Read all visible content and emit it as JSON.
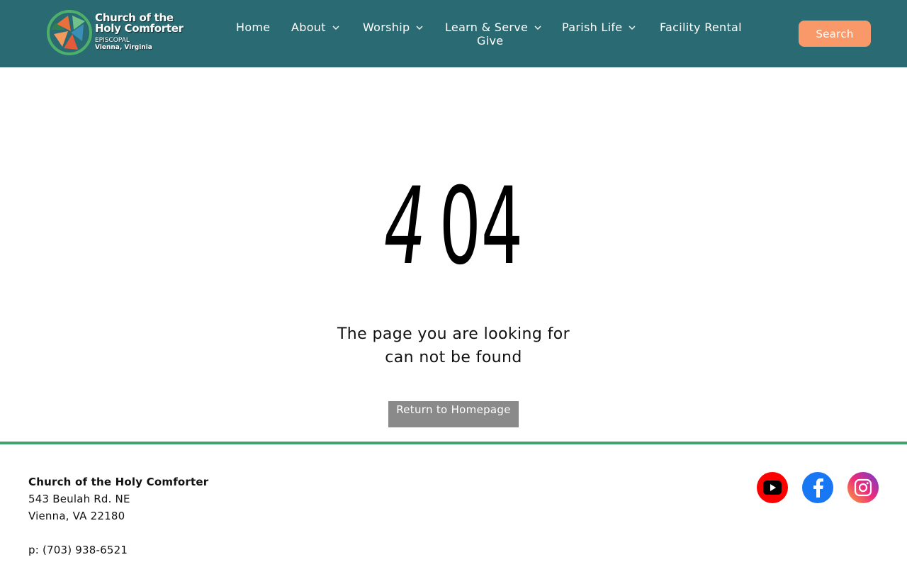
{
  "header": {
    "logo": {
      "title_line1": "Church of the",
      "title_line2": "Holy Comforter",
      "sub_line1": "EPISCOPAL",
      "sub_line2": "Vienna, Virginia"
    },
    "nav": [
      {
        "label": "Home",
        "has_dropdown": false
      },
      {
        "label": "About",
        "has_dropdown": true
      },
      {
        "label": "Worship",
        "has_dropdown": true
      },
      {
        "label": "Learn & Serve",
        "has_dropdown": true
      },
      {
        "label": "Parish Life",
        "has_dropdown": true
      },
      {
        "label": "Facility Rental",
        "has_dropdown": false
      },
      {
        "label": "Give",
        "has_dropdown": false
      }
    ],
    "search_label": "Search",
    "colors": {
      "header_bg": "#2a6a72",
      "search_bg": "#f99868"
    }
  },
  "main": {
    "error_code_part1": "4",
    "error_code_part2": "04",
    "message_line1": "The page you are looking for",
    "message_line2": "can not be found",
    "button_label": "Return to Homepage"
  },
  "footer": {
    "name": "Church of the Holy Comforter",
    "address_line1": "543 Beulah Rd. NE",
    "address_line2": "Vienna, VA 22180",
    "phone": "p: (703) 938-6521",
    "social": [
      {
        "icon": "youtube-icon",
        "color": "#ff0000"
      },
      {
        "icon": "facebook-icon",
        "color": "#1877f2"
      },
      {
        "icon": "instagram-icon",
        "color": "#e1306c"
      }
    ],
    "divider_color": "#3fa36a"
  }
}
